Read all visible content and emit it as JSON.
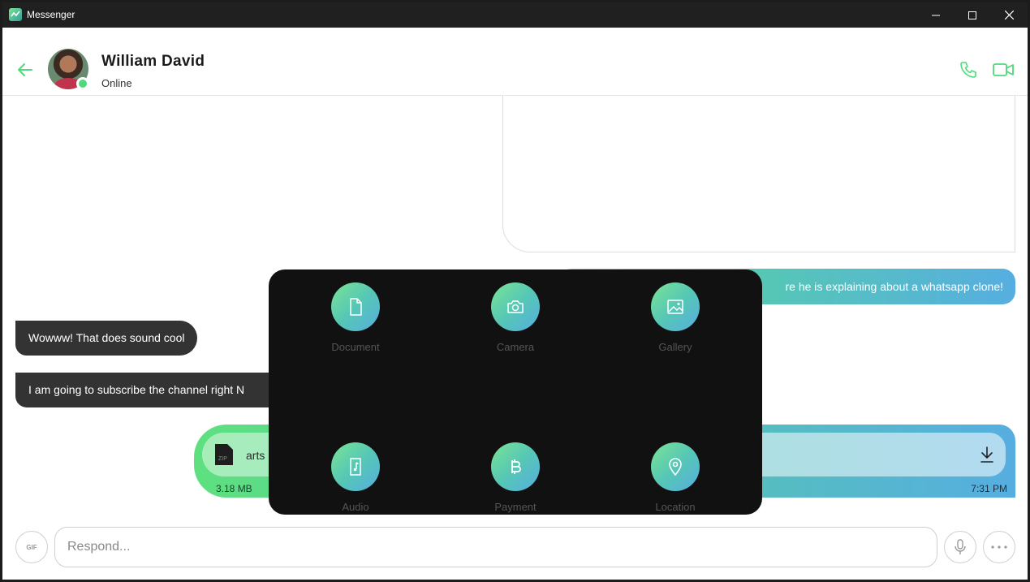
{
  "window": {
    "title": "Messenger"
  },
  "contact": {
    "name": "William David",
    "status": "Online"
  },
  "messages": {
    "outgoing_text": "re he is explaining about a whatsapp clone!",
    "incoming": [
      {
        "text": "Wowww! That does sound cool"
      },
      {
        "text": "I am going to subscribe the channel right N"
      }
    ],
    "file": {
      "name": "arts",
      "size": "3.18 MB",
      "time": "7:31 PM",
      "type_badge": "ZIP"
    }
  },
  "attach_menu": {
    "items": [
      {
        "label": "Document",
        "icon": "document-icon"
      },
      {
        "label": "Camera",
        "icon": "camera-icon"
      },
      {
        "label": "Gallery",
        "icon": "gallery-icon"
      },
      {
        "label": "Audio",
        "icon": "audio-icon"
      },
      {
        "label": "Payment",
        "icon": "bitcoin-icon"
      },
      {
        "label": "Location",
        "icon": "location-pin-icon"
      }
    ]
  },
  "composer": {
    "placeholder": "Respond...",
    "gif_label": "GIF"
  },
  "colors": {
    "accent_green": "#4fd97a",
    "gradient_start": "#7be495",
    "gradient_end": "#56aee0",
    "bubble_incoming": "#333333",
    "menu_bg": "#111111"
  }
}
